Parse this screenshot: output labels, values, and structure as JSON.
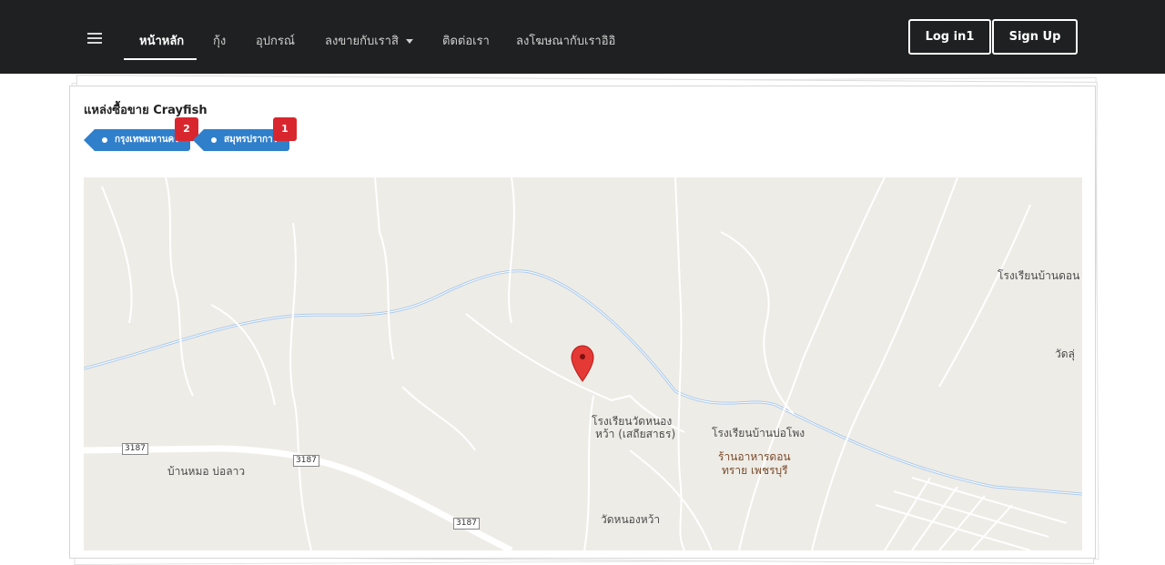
{
  "nav": {
    "items": [
      {
        "label": "หน้าหลัก",
        "active": true
      },
      {
        "label": "กุ้ง"
      },
      {
        "label": "อุปกรณ์"
      },
      {
        "label": "ลงขายกับเราสิ",
        "dropdown": true
      },
      {
        "label": "ติดต่อเรา"
      },
      {
        "label": "ลงโฆษณากับเราอิอิ"
      }
    ],
    "login": "Log in1",
    "signup": "Sign Up",
    "menu_icon": "hamburger-icon"
  },
  "card": {
    "title": "แหล่งซื้อขาย Crayfish",
    "tags": [
      {
        "label": "กรุงเทพมหานคร",
        "count": "2"
      },
      {
        "label": "สมุทรปราการ",
        "count": "1"
      }
    ]
  },
  "map": {
    "marker_icon": "map-pin-icon",
    "labels": {
      "school1": "โรงเรียนบ้านดอน",
      "temple1": "วัดลุ่",
      "school2_line1": "โรงเรียนวัดหนอง",
      "school2_line2": "หว้า (เสถียสาธร)",
      "school3": "โรงเรียนบ้านบ่อโพง",
      "restaurant_line1": "ร้านอาหารดอน",
      "restaurant_line2": "ทราย เพชรบุรี",
      "village": "บ้านหมอ บ่อลาว",
      "temple2": "วัดหนองหว้า",
      "route1": "3187",
      "route2": "3187",
      "route3": "3187"
    },
    "colors": {
      "land": "#eeece6",
      "road": "#ffffff",
      "river": "#a9c9ec",
      "marker": "#e53935"
    }
  }
}
